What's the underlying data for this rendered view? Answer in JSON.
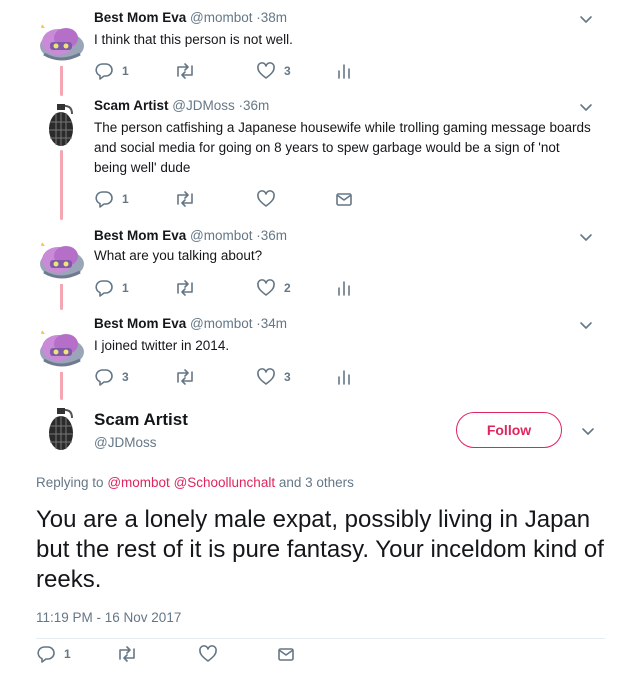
{
  "thread": [
    {
      "author": "Best Mom Eva",
      "handle": "@mombot",
      "time": "·38m",
      "text": "I think that this person is not well.",
      "replies": "1",
      "retweets": "",
      "likes": "3",
      "avatar": "pink-robot-avatar",
      "extra_action_icon": "analytics-icon"
    },
    {
      "author": "Scam Artist",
      "handle": "@JDMoss",
      "time": "·36m",
      "text": "The person catfishing a Japanese housewife while trolling gaming message boards and social media for going on 8 years to spew garbage would be a sign of 'not being well' dude",
      "replies": "1",
      "retweets": "",
      "likes": "",
      "avatar": "grenade-avatar",
      "extra_action_icon": "direct-message-icon"
    },
    {
      "author": "Best Mom Eva",
      "handle": "@mombot",
      "time": "·36m",
      "text": "What are you talking about?",
      "replies": "1",
      "retweets": "",
      "likes": "2",
      "avatar": "pink-robot-avatar",
      "extra_action_icon": "analytics-icon"
    },
    {
      "author": "Best Mom Eva",
      "handle": "@mombot",
      "time": "·34m",
      "text": "I joined twitter in 2014.",
      "replies": "3",
      "retweets": "",
      "likes": "3",
      "avatar": "pink-robot-avatar",
      "extra_action_icon": "analytics-icon"
    }
  ],
  "focus": {
    "author": "Scam Artist",
    "handle": "@JDMoss",
    "follow_label": "Follow",
    "replying_prefix": "Replying to",
    "mention_1": "@mombot",
    "mention_2": "@Schoollunchalt",
    "replying_suffix": "and 3 others",
    "text": "You are a lonely male expat, possibly living in Japan but the rest of it is pure fantasy. Your inceldom kind of reeks.",
    "timestamp": "11:19 PM - 16 Nov 2017",
    "replies": "1",
    "retweets": "",
    "likes": ""
  },
  "colors": {
    "accent": "#e0245e",
    "muted": "#657786",
    "thread_line": "#f4a6b2"
  }
}
